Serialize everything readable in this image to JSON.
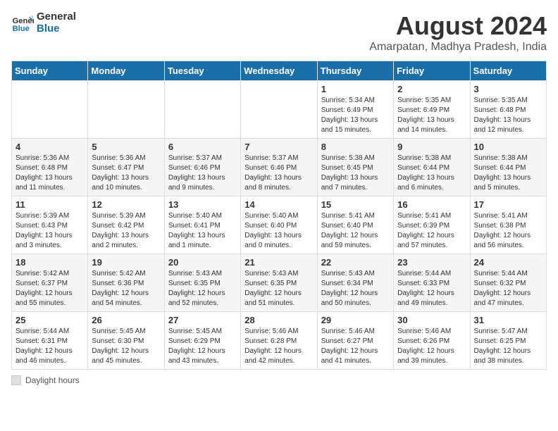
{
  "header": {
    "logo_line1": "General",
    "logo_line2": "Blue",
    "month_title": "August 2024",
    "subtitle": "Amarpatan, Madhya Pradesh, India"
  },
  "days_of_week": [
    "Sunday",
    "Monday",
    "Tuesday",
    "Wednesday",
    "Thursday",
    "Friday",
    "Saturday"
  ],
  "weeks": [
    [
      {
        "day": "",
        "info": ""
      },
      {
        "day": "",
        "info": ""
      },
      {
        "day": "",
        "info": ""
      },
      {
        "day": "",
        "info": ""
      },
      {
        "day": "1",
        "info": "Sunrise: 5:34 AM\nSunset: 6:49 PM\nDaylight: 13 hours\nand 15 minutes."
      },
      {
        "day": "2",
        "info": "Sunrise: 5:35 AM\nSunset: 6:49 PM\nDaylight: 13 hours\nand 14 minutes."
      },
      {
        "day": "3",
        "info": "Sunrise: 5:35 AM\nSunset: 6:48 PM\nDaylight: 13 hours\nand 12 minutes."
      }
    ],
    [
      {
        "day": "4",
        "info": "Sunrise: 5:36 AM\nSunset: 6:48 PM\nDaylight: 13 hours\nand 11 minutes."
      },
      {
        "day": "5",
        "info": "Sunrise: 5:36 AM\nSunset: 6:47 PM\nDaylight: 13 hours\nand 10 minutes."
      },
      {
        "day": "6",
        "info": "Sunrise: 5:37 AM\nSunset: 6:46 PM\nDaylight: 13 hours\nand 9 minutes."
      },
      {
        "day": "7",
        "info": "Sunrise: 5:37 AM\nSunset: 6:46 PM\nDaylight: 13 hours\nand 8 minutes."
      },
      {
        "day": "8",
        "info": "Sunrise: 5:38 AM\nSunset: 6:45 PM\nDaylight: 13 hours\nand 7 minutes."
      },
      {
        "day": "9",
        "info": "Sunrise: 5:38 AM\nSunset: 6:44 PM\nDaylight: 13 hours\nand 6 minutes."
      },
      {
        "day": "10",
        "info": "Sunrise: 5:38 AM\nSunset: 6:44 PM\nDaylight: 13 hours\nand 5 minutes."
      }
    ],
    [
      {
        "day": "11",
        "info": "Sunrise: 5:39 AM\nSunset: 6:43 PM\nDaylight: 13 hours\nand 3 minutes."
      },
      {
        "day": "12",
        "info": "Sunrise: 5:39 AM\nSunset: 6:42 PM\nDaylight: 13 hours\nand 2 minutes."
      },
      {
        "day": "13",
        "info": "Sunrise: 5:40 AM\nSunset: 6:41 PM\nDaylight: 13 hours\nand 1 minute."
      },
      {
        "day": "14",
        "info": "Sunrise: 5:40 AM\nSunset: 6:40 PM\nDaylight: 13 hours\nand 0 minutes."
      },
      {
        "day": "15",
        "info": "Sunrise: 5:41 AM\nSunset: 6:40 PM\nDaylight: 12 hours\nand 59 minutes."
      },
      {
        "day": "16",
        "info": "Sunrise: 5:41 AM\nSunset: 6:39 PM\nDaylight: 12 hours\nand 57 minutes."
      },
      {
        "day": "17",
        "info": "Sunrise: 5:41 AM\nSunset: 6:38 PM\nDaylight: 12 hours\nand 56 minutes."
      }
    ],
    [
      {
        "day": "18",
        "info": "Sunrise: 5:42 AM\nSunset: 6:37 PM\nDaylight: 12 hours\nand 55 minutes."
      },
      {
        "day": "19",
        "info": "Sunrise: 5:42 AM\nSunset: 6:36 PM\nDaylight: 12 hours\nand 54 minutes."
      },
      {
        "day": "20",
        "info": "Sunrise: 5:43 AM\nSunset: 6:35 PM\nDaylight: 12 hours\nand 52 minutes."
      },
      {
        "day": "21",
        "info": "Sunrise: 5:43 AM\nSunset: 6:35 PM\nDaylight: 12 hours\nand 51 minutes."
      },
      {
        "day": "22",
        "info": "Sunrise: 5:43 AM\nSunset: 6:34 PM\nDaylight: 12 hours\nand 50 minutes."
      },
      {
        "day": "23",
        "info": "Sunrise: 5:44 AM\nSunset: 6:33 PM\nDaylight: 12 hours\nand 49 minutes."
      },
      {
        "day": "24",
        "info": "Sunrise: 5:44 AM\nSunset: 6:32 PM\nDaylight: 12 hours\nand 47 minutes."
      }
    ],
    [
      {
        "day": "25",
        "info": "Sunrise: 5:44 AM\nSunset: 6:31 PM\nDaylight: 12 hours\nand 46 minutes."
      },
      {
        "day": "26",
        "info": "Sunrise: 5:45 AM\nSunset: 6:30 PM\nDaylight: 12 hours\nand 45 minutes."
      },
      {
        "day": "27",
        "info": "Sunrise: 5:45 AM\nSunset: 6:29 PM\nDaylight: 12 hours\nand 43 minutes."
      },
      {
        "day": "28",
        "info": "Sunrise: 5:46 AM\nSunset: 6:28 PM\nDaylight: 12 hours\nand 42 minutes."
      },
      {
        "day": "29",
        "info": "Sunrise: 5:46 AM\nSunset: 6:27 PM\nDaylight: 12 hours\nand 41 minutes."
      },
      {
        "day": "30",
        "info": "Sunrise: 5:46 AM\nSunset: 6:26 PM\nDaylight: 12 hours\nand 39 minutes."
      },
      {
        "day": "31",
        "info": "Sunrise: 5:47 AM\nSunset: 6:25 PM\nDaylight: 12 hours\nand 38 minutes."
      }
    ]
  ],
  "legend": {
    "label": "Daylight hours"
  },
  "colors": {
    "header_bg": "#1a6fa8",
    "accent": "#1a6fa8"
  }
}
